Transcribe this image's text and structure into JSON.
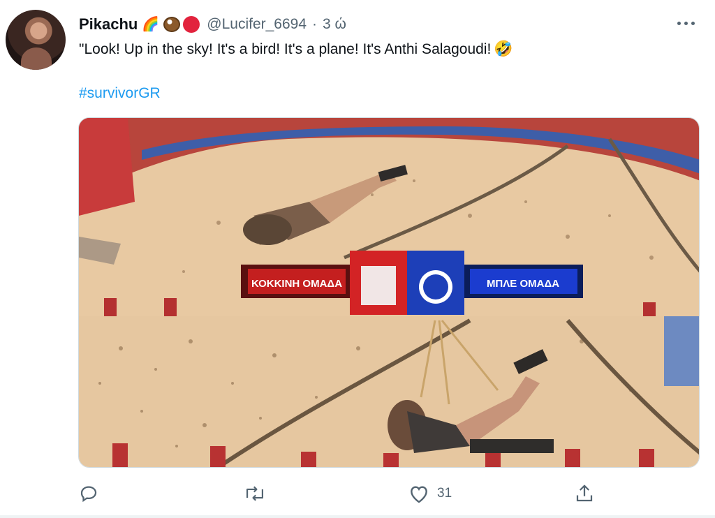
{
  "tweet": {
    "author_name": "Pikachu",
    "handle": "@Lucifer_6694",
    "separator": "·",
    "time": "3 ώ",
    "emoji": {
      "rainbow": "🌈",
      "coconut_icon": "coconut-icon",
      "red_circle_icon": "red-circle-icon"
    },
    "text": "\"Look! Up in the sky! It's a bird! It's a plane! It's Anthi Salagoudi!",
    "laugh_emoji": "🤣",
    "hashtag": "#survivorGR"
  },
  "media": {
    "banner_left": "ΚΟΚΚΙΝΗ ΟΜΑΔΑ",
    "banner_right": "ΜΠΛΕ ΟΜΑΔΑ",
    "red_team_color": "#d32325",
    "blue_team_color": "#1d3fb8"
  },
  "actions": {
    "reply_icon": "reply-icon",
    "retweet_icon": "retweet-icon",
    "like_icon": "like-icon",
    "like_count": "31",
    "share_icon": "share-icon"
  },
  "colors": {
    "accent": "#1d9bf0",
    "muted": "#536471"
  }
}
